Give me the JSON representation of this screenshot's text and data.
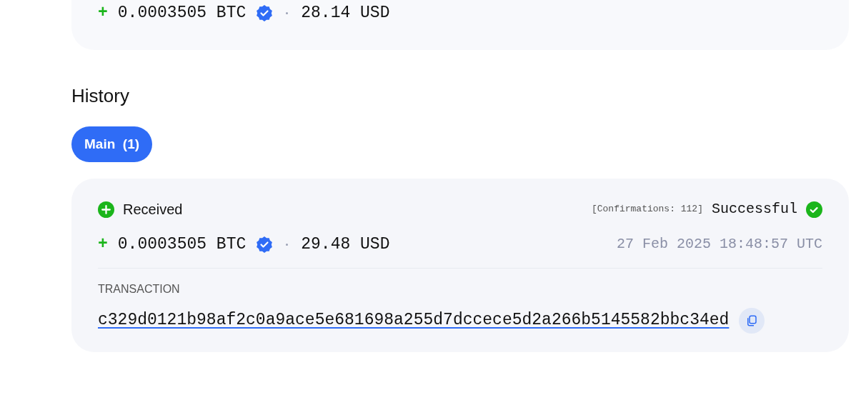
{
  "top_transaction": {
    "sign": "+",
    "amount": "0.0003505 BTC",
    "verified": true,
    "fiat": "28.14 USD"
  },
  "history": {
    "title": "History",
    "tabs": [
      {
        "label": "Main",
        "count": "(1)",
        "selected": true
      }
    ],
    "transactions": [
      {
        "kind": "received",
        "label": "Received",
        "confirmations": "[Confirmations: 112]",
        "status": "Successful",
        "successful": true,
        "sign": "+",
        "amount": "0.0003505 BTC",
        "verified": true,
        "fiat": "29.48 USD",
        "date": "27 Feb 2025 18:48:57 UTC",
        "section_label": "TRANSACTION",
        "hash": "c329d0121b98af2c0a9ace5e681698a255d7dccece5d2a266b5145582bbc34ed"
      }
    ]
  }
}
